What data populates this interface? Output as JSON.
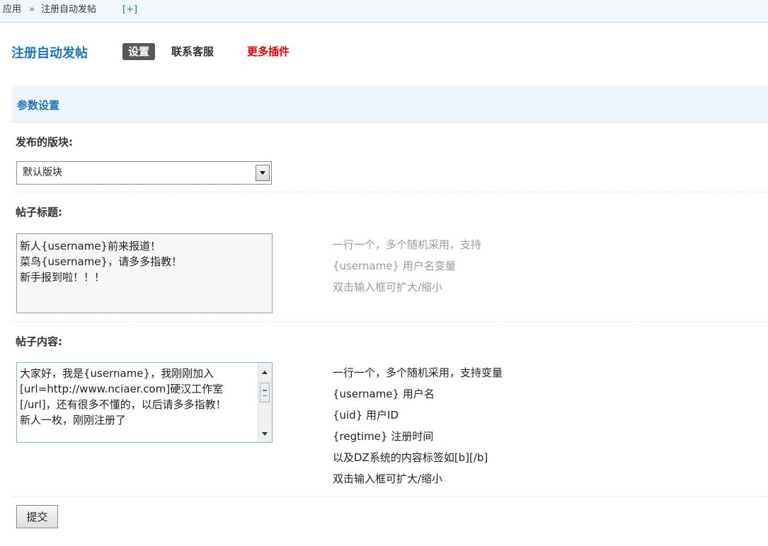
{
  "breadcrumb": {
    "app": "应用",
    "separator": "»",
    "page": "注册自动发帖",
    "add": "[+]"
  },
  "header": {
    "plugin_title": "注册自动发帖",
    "tabs": [
      {
        "label": "设置",
        "active": true
      },
      {
        "label": "联系客服",
        "active": false
      },
      {
        "label": "更多插件",
        "active": false,
        "color": "#e00000"
      }
    ]
  },
  "section": {
    "title": "参数设置"
  },
  "fields": {
    "forum": {
      "label": "发布的版块:",
      "selected": "默认版块"
    },
    "post_title": {
      "label": "帖子标题:",
      "value": "新人{username}前来报道！\n菜鸟{username}，请多多指教！\n新手报到啦！！！",
      "hints": [
        "一行一个，多个随机采用，支持",
        "{username} 用户名变量",
        "双击输入框可扩大/缩小"
      ]
    },
    "post_content": {
      "label": "帖子内容:",
      "value": "大家好，我是{username}，我刚刚加入[url=http://www.nciaer.com]硬汉工作室[/url]，还有很多不懂的，以后请多多指教！\n新人一枚，刚刚注册了",
      "hints": [
        "一行一个，多个随机采用，支持变量",
        "{username} 用户名",
        "{uid} 用户ID",
        "{regtime} 注册时间",
        "以及DZ系统的内容标签如[b][/b]",
        "双击输入框可扩大/缩小"
      ]
    }
  },
  "submit_label": "提交",
  "colors": {
    "accent": "#1f74b3",
    "more_plugins": "#e00000",
    "active_tab_bg": "#585858"
  }
}
